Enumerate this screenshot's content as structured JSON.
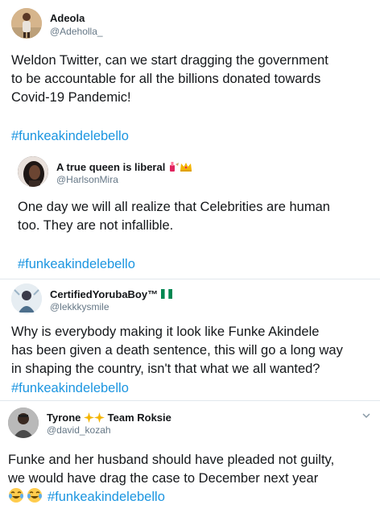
{
  "tweets": [
    {
      "name": "Adeola",
      "handle": "@Adeholla_",
      "text": "Weldon Twitter, can we start dragging the government\nto be accountable for all the billions donated towards\nCovid-19 Pandemic!",
      "hashtag": "#funkeakindelebello"
    },
    {
      "name": "A true queen is liberal",
      "handle": "@HarlsonMira",
      "text": "One day we will all realize that Celebrities are human\ntoo. They are not infallible.",
      "hashtag": "#funkeakindelebello"
    },
    {
      "name": "CertifiedYorubaBoy™",
      "handle": "@lekkkysmile",
      "text": "Why is everybody making it look like Funke Akindele\nhas been given a death sentence, this will go a long way\nin shaping the country, isn't that what we all wanted?",
      "hashtag": "#funkeakindelebello"
    },
    {
      "name_before": "Tyrone",
      "name_after": "Team Roksie",
      "handle": "@david_kozah",
      "text": "Funke and her husband should have pleaded not guilty,\nwe would have drag the case to December next year",
      "hashtag": "#funkeakindelebello"
    }
  ],
  "icons": {
    "nail_polish": "nail-polish-emoji",
    "crown": "crown-emoji",
    "flag": "nigeria-flag-emoji",
    "sparkles": "sparkles-emoji",
    "laughing": "tears-of-joy-emoji",
    "chevron": "chevron-down-icon"
  },
  "colors": {
    "hashtag": "#1b95e0",
    "handle": "#657786",
    "divider": "#e1e8ed"
  }
}
